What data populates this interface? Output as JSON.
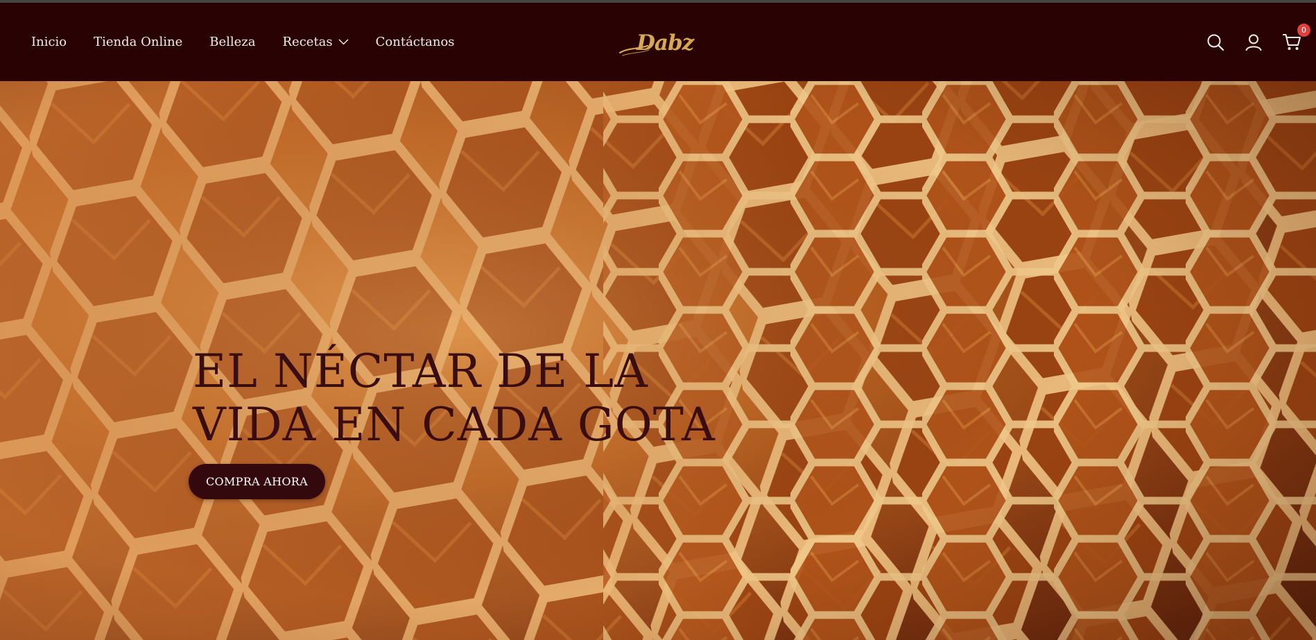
{
  "nav": {
    "items": [
      {
        "label": "Inicio"
      },
      {
        "label": "Tienda Online"
      },
      {
        "label": "Belleza"
      },
      {
        "label": "Recetas",
        "has_dropdown": true
      },
      {
        "label": "Contáctanos"
      }
    ]
  },
  "brand": {
    "logo_text": "Dabz",
    "logo_color": "#d6a853"
  },
  "header_icons": {
    "search": "search-icon",
    "account": "user-icon",
    "cart": "cart-icon",
    "cart_count": "0"
  },
  "hero": {
    "title_line1": "EL NÉCTAR DE LA",
    "title_line2": "VIDA EN CADA GOTA",
    "cta_label": "COMPRA AHORA"
  },
  "colors": {
    "header_bg": "#290304",
    "cta_bg": "#34090d",
    "badge": "#e0413d",
    "title": "#3a0e10"
  }
}
